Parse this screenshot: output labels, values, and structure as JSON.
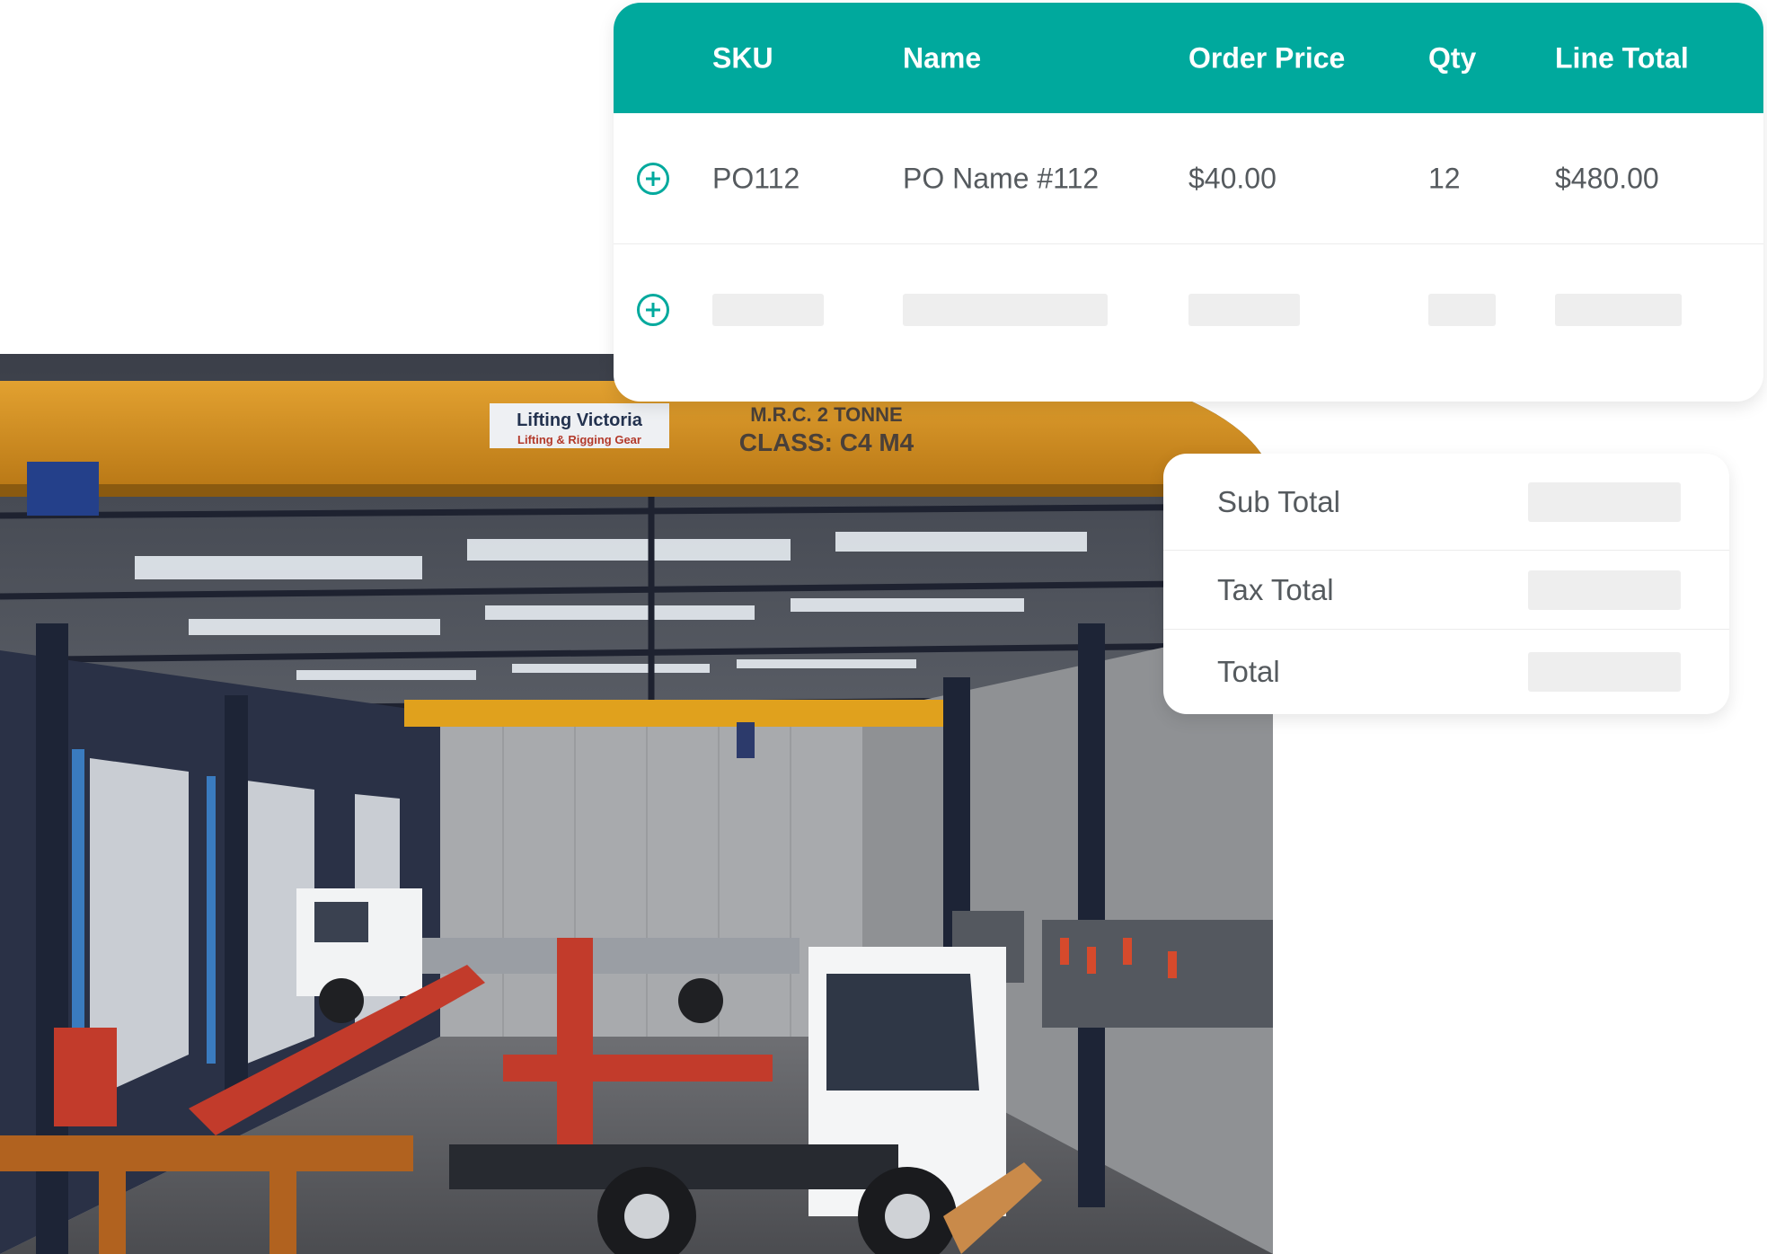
{
  "colors": {
    "accent": "#00a99d",
    "text": "#555a5e",
    "placeholder": "#eeeeee",
    "header_text": "#ffffff"
  },
  "photo": {
    "subject": "warehouse workshop with overhead cranes and trucks",
    "crane_sign": "Lifting Victoria",
    "crane_sign_sub": "Lifting & Rigging Gear",
    "crane_rating": "M.R.C. 2 TONNE",
    "crane_class": "CLASS: C4 M4"
  },
  "order_table": {
    "headers": {
      "sku": "SKU",
      "name": "Name",
      "order_price": "Order Price",
      "qty": "Qty",
      "line_total": "Line Total"
    },
    "rows": [
      {
        "sku": "PO112",
        "name": "PO Name #112",
        "order_price": "$40.00",
        "qty": "12",
        "line_total": "$480.00",
        "add_icon": "plus-circle-icon"
      }
    ],
    "placeholder_row": {
      "add_icon": "plus-circle-icon"
    }
  },
  "totals": {
    "sub_total_label": "Sub Total",
    "tax_total_label": "Tax Total",
    "total_label": "Total"
  }
}
